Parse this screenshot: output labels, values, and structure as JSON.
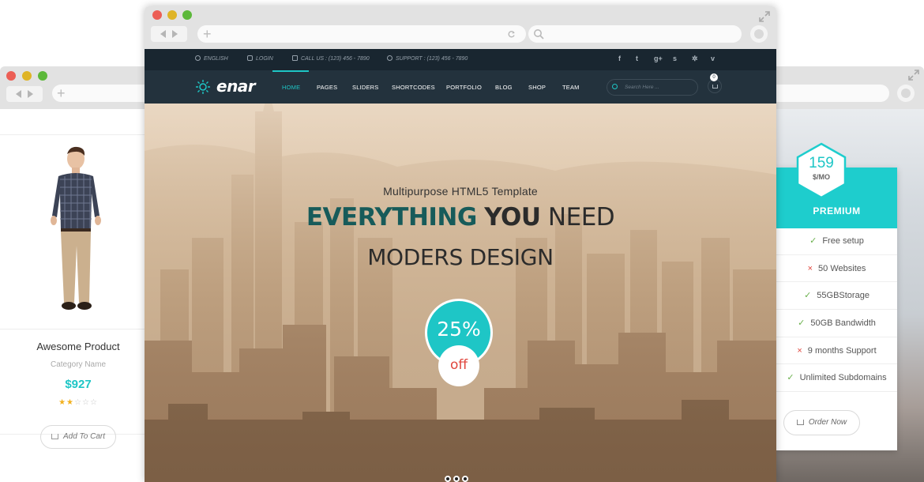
{
  "left_window": {
    "product": {
      "name": "Awesome Product",
      "category": "Category Name",
      "price": "$927",
      "rating": 2,
      "rating_max": 5,
      "add_to_cart_label": "Add To Cart"
    }
  },
  "right_window": {
    "pricing": {
      "price": "159",
      "unit": "$/MO",
      "plan": "PREMIUM",
      "features": [
        {
          "label": "Free setup",
          "included": true
        },
        {
          "label": "50 Websites",
          "included": false
        },
        {
          "label": "55GBStorage",
          "included": true
        },
        {
          "label": "50GB Bandwidth",
          "included": true
        },
        {
          "label": "9 months Support",
          "included": false
        },
        {
          "label": "Unlimited Subdomains",
          "included": true
        }
      ],
      "order_label": "Order Now"
    }
  },
  "front_window": {
    "topbar": {
      "language": "ENGLISH",
      "login": "LOGIN",
      "call": "CALL US : (123) 456 - 7890",
      "support": "SUPPORT : (123) 456 - 7890",
      "social_icons": [
        "f",
        "t",
        "g+",
        "s",
        "gear",
        "v"
      ]
    },
    "nav": {
      "logo": "enar",
      "items": [
        "HOME",
        "PAGES",
        "SLIDERS",
        "SHORTCODES",
        "PORTFOLIO",
        "BLOG",
        "SHOP",
        "TEAM"
      ],
      "active": "HOME",
      "search_placeholder": "Search Here ...",
      "cart_count": "0"
    },
    "hero": {
      "subtitle": "Multipurpose HTML5 Template",
      "title_part1": "EVERYTHING",
      "title_part2": "YOU",
      "title_part3": "NEED",
      "title_line2": "MODERS DESIGN",
      "badge_percent": "25%",
      "badge_off": "off",
      "slides": 3,
      "active_slide": 2
    }
  },
  "colors": {
    "accent": "#1ec6c6",
    "topbar_bg": "#192630",
    "nav_bg": "#23323d",
    "danger": "#e0453c",
    "success": "#6ab04c"
  }
}
